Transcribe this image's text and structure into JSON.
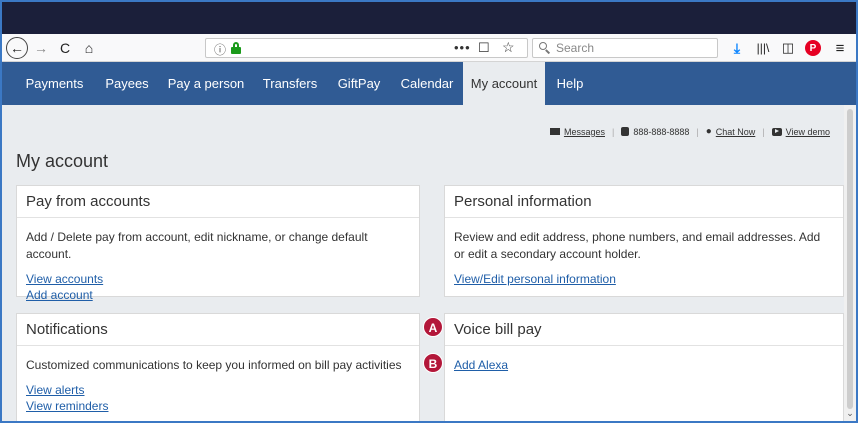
{
  "browser": {
    "url_info": "ⓘ",
    "search_placeholder": "Search",
    "back_symbol": "←",
    "forward_symbol": "→",
    "reload_symbol": "C",
    "home_symbol": "⌂",
    "page_actions_symbol": "•••",
    "pocket_symbol": "☐",
    "bookmark_symbol": "☆",
    "download_symbol": "⤓",
    "library_symbol": "|||\\",
    "sidebar_symbol": "◫",
    "pinterest_symbol": "P",
    "menu_symbol": "≡"
  },
  "nav": {
    "items": [
      {
        "label": "Payments"
      },
      {
        "label": "Payees"
      },
      {
        "label": "Pay a person"
      },
      {
        "label": "Transfers"
      },
      {
        "label": "GiftPay"
      },
      {
        "label": "Calendar"
      },
      {
        "label": "My account"
      },
      {
        "label": "Help"
      }
    ],
    "active": "My account"
  },
  "utility": {
    "messages": "Messages",
    "phone": "888-888-8888",
    "chat": "Chat Now",
    "demo": "View demo"
  },
  "page": {
    "title": "My account"
  },
  "cards": {
    "pay_from": {
      "title": "Pay from accounts",
      "description": "Add / Delete pay from account, edit nickname, or change default account.",
      "links": [
        "View accounts",
        "Add account"
      ]
    },
    "personal": {
      "title": "Personal information",
      "description": "Review and edit address, phone numbers, and email addresses. Add or edit a secondary account holder.",
      "links": [
        "View/Edit personal information"
      ]
    },
    "notifications": {
      "title": "Notifications",
      "description": "Customized communications to keep you informed on bill pay activities",
      "links": [
        "View alerts",
        "View reminders"
      ]
    },
    "voice": {
      "title": "Voice bill pay",
      "links": [
        "Add Alexa"
      ]
    }
  },
  "callouts": {
    "a": "A",
    "b": "B"
  },
  "colors": {
    "nav_bg": "#305b94",
    "link": "#1f5ea8",
    "badge": "#b3173a",
    "titlebar": "#1b1f3a"
  }
}
